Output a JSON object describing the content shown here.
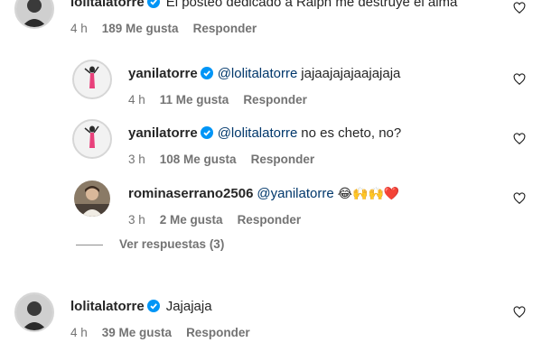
{
  "comments": [
    {
      "username": "lolitalatorre",
      "text": "El posteo dedicado a Ralph me destruye el alma",
      "time": "4 h",
      "likes": "189 Me gusta",
      "reply": "Responder"
    },
    {
      "username": "yanilatorre",
      "mention": "@lolitalatorre",
      "text": "jajaajajajaajajaja",
      "time": "4 h",
      "likes": "11 Me gusta",
      "reply": "Responder"
    },
    {
      "username": "yanilatorre",
      "mention": "@lolitalatorre",
      "text": "no es cheto, no?",
      "time": "3 h",
      "likes": "108 Me gusta",
      "reply": "Responder"
    },
    {
      "username": "rominaserrano2506",
      "mention": "@yanilatorre",
      "text": "😂🙌🙌❤️",
      "time": "3 h",
      "likes": "2 Me gusta",
      "reply": "Responder"
    },
    {
      "username": "lolitalatorre",
      "text": "Jajajaja",
      "time": "4 h",
      "likes": "39 Me gusta",
      "reply": "Responder"
    }
  ],
  "view_replies": "Ver respuestas (3)",
  "icons": {
    "verified": "verified-badge-icon",
    "like": "heart-outline-icon"
  },
  "colors": {
    "verified": "#0095f6",
    "mention": "#00376b",
    "meta": "#737373"
  }
}
